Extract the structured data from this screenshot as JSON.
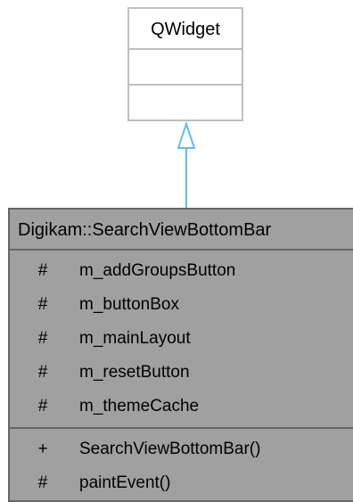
{
  "parent_class": {
    "name": "QWidget",
    "attributes": [],
    "methods": []
  },
  "class": {
    "name": "Digikam::SearchViewBottomBar",
    "attributes": [
      {
        "visibility": "#",
        "name": "m_addGroupsButton"
      },
      {
        "visibility": "#",
        "name": "m_buttonBox"
      },
      {
        "visibility": "#",
        "name": "m_mainLayout"
      },
      {
        "visibility": "#",
        "name": "m_resetButton"
      },
      {
        "visibility": "#",
        "name": "m_themeCache"
      }
    ],
    "methods": [
      {
        "visibility": "+",
        "name": "SearchViewBottomBar()"
      },
      {
        "visibility": "#",
        "name": "paintEvent()"
      }
    ]
  },
  "relation": {
    "type": "inheritance",
    "from": "Digikam::SearchViewBottomBar",
    "to": "QWidget"
  },
  "colors": {
    "parent_border": "#bfbfbf",
    "class_fill": "#a0a0a0",
    "class_border": "#666666",
    "arrow": "#63b8ff"
  }
}
